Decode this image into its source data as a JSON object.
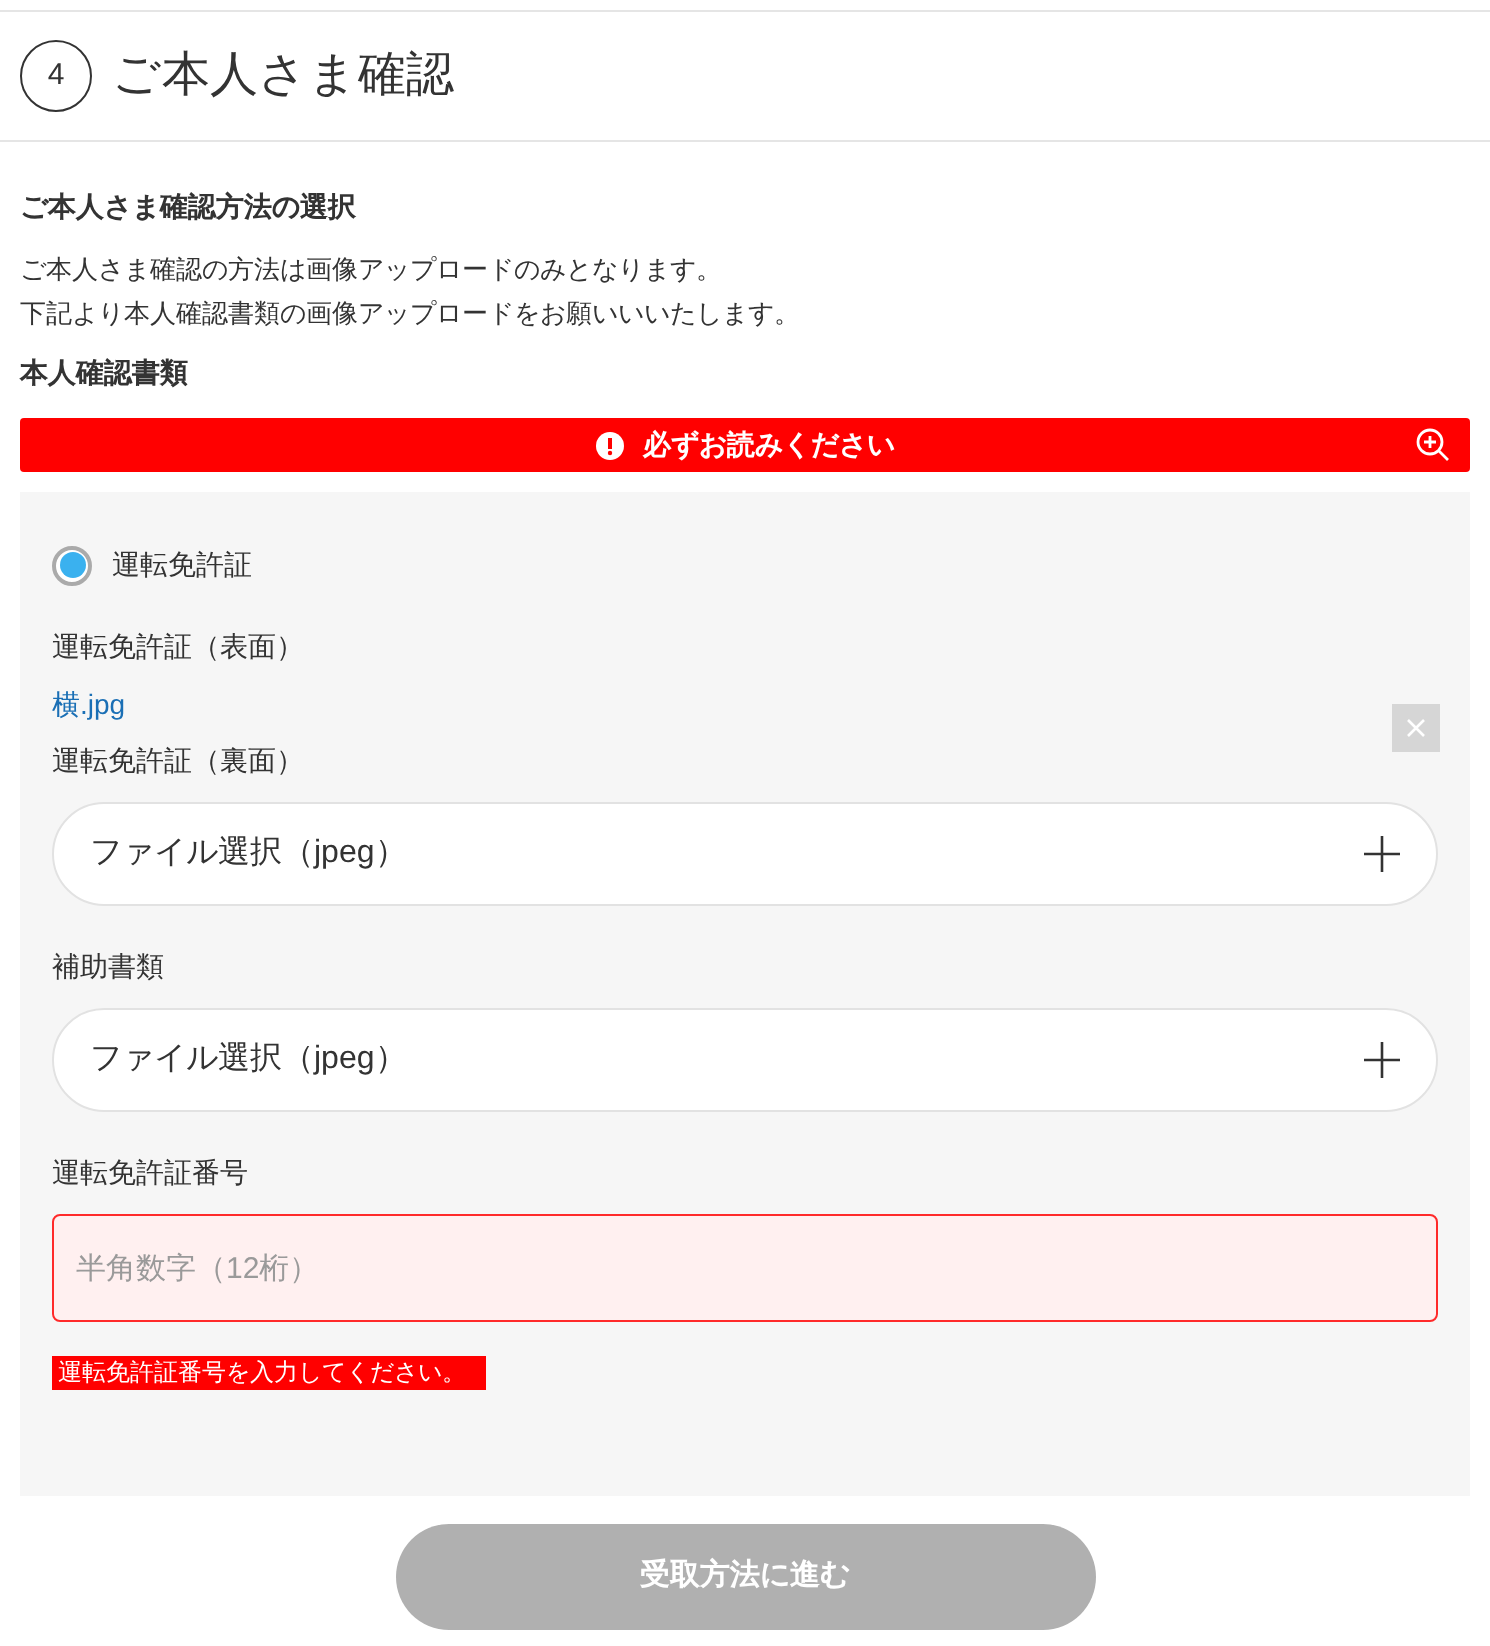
{
  "header": {
    "step": "4",
    "title": "ご本人さま確認"
  },
  "method": {
    "heading": "ご本人さま確認方法の選択",
    "description": [
      "ご本人さま確認の方法は画像アップロードのみとなります。",
      "下記より本人確認書類の画像アップロードをお願いいいたします。"
    ]
  },
  "documents": {
    "heading": "本人確認書類",
    "notice": "必ずお読みください",
    "options": [
      {
        "label": "運転免許証",
        "selected": true
      }
    ],
    "fields": [
      {
        "kind": "uploaded",
        "label": "運転免許証（表面）",
        "file": "横.jpg"
      },
      {
        "kind": "file",
        "label": "運転免許証（裏面）",
        "placeholder": "ファイル選択（jpeg）"
      },
      {
        "kind": "file",
        "label": "補助書類",
        "placeholder": "ファイル選択（jpeg）"
      },
      {
        "kind": "text",
        "label": "運転免許証番号",
        "placeholder": "半角数字（12桁）",
        "invalid": true,
        "error": "運転免許証番号を入力してください。"
      }
    ]
  },
  "next_button": {
    "label": "受取方法に進む",
    "disabled": true
  }
}
